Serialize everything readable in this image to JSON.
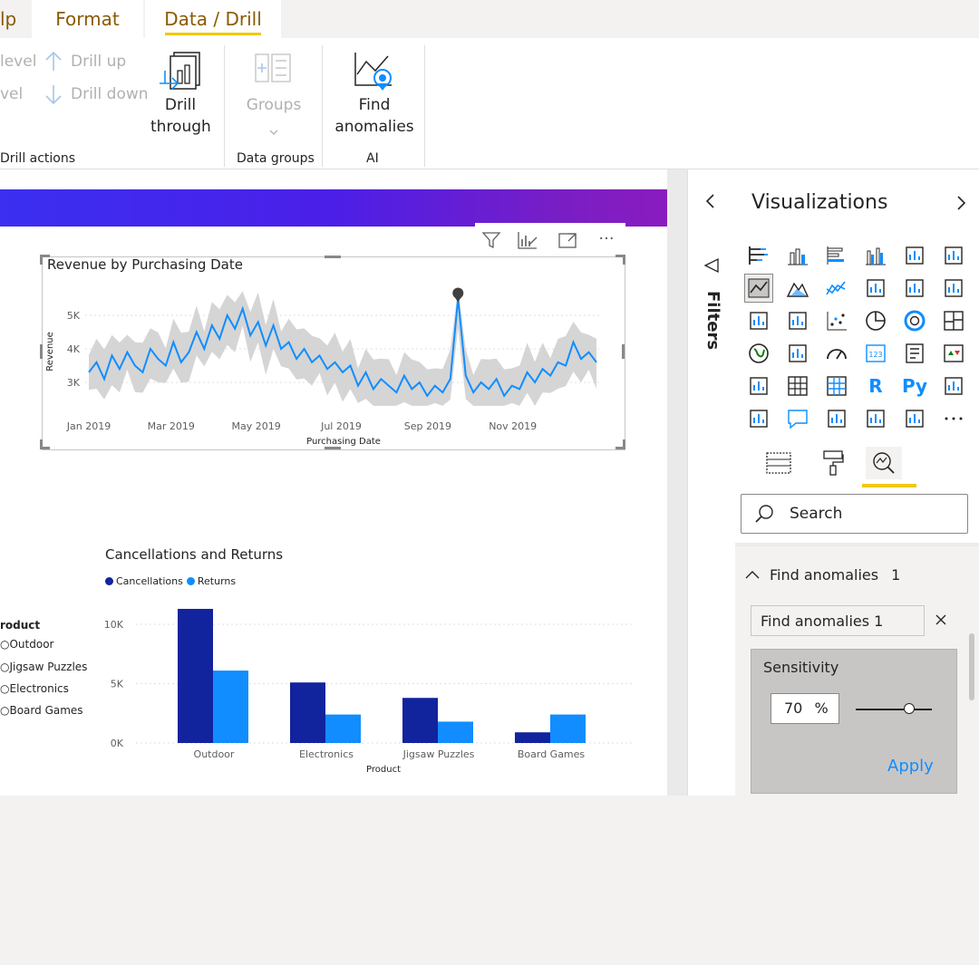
{
  "ribbon": {
    "tabs": [
      {
        "label": "lp",
        "active": false
      },
      {
        "label": "Format",
        "active": false
      },
      {
        "label": "Data / Drill",
        "active": true
      }
    ],
    "drill_actions": {
      "next_level": "level",
      "expand_level": "vel",
      "drill_up": "Drill up",
      "drill_down": "Drill down",
      "drill_through_line1": "Drill",
      "drill_through_line2": "through",
      "group_label": "Drill actions"
    },
    "data_groups": {
      "groups_label": "Groups",
      "group_label": "Data groups"
    },
    "ai": {
      "find_line1": "Find",
      "find_line2": "anomalies",
      "group_label": "AI"
    },
    "accent_color": "#f2c811"
  },
  "line_chart": {
    "title": "Revenue by Purchasing Date",
    "xlabel": "Purchasing Date",
    "ylabel": "Revenue",
    "y_ticks": [
      "5K",
      "4K",
      "3K"
    ],
    "x_ticks": [
      "Jan 2019",
      "Mar 2019",
      "May 2019",
      "Jul 2019",
      "Sep 2019",
      "Nov 2019"
    ],
    "line_color": "#118dff",
    "band_color": "#d0d0d0",
    "anomaly_color": "#404040"
  },
  "bar_chart": {
    "title": "Cancellations and Returns",
    "legend": [
      {
        "name": "Cancellations",
        "color": "#12239e"
      },
      {
        "name": "Returns",
        "color": "#118dff"
      }
    ],
    "y_ticks": [
      "10K",
      "5K",
      "0K"
    ],
    "xlabel": "Product"
  },
  "slicer": {
    "title": "roduct",
    "items": [
      "Outdoor",
      "Jigsaw Puzzles",
      "Electronics",
      "Board Games"
    ]
  },
  "filters": {
    "label": "Filters"
  },
  "visualizations": {
    "title": "Visualizations",
    "search_placeholder": "Search",
    "section_title": "Find anomalies",
    "section_count": "1",
    "item_name": "Find anomalies 1",
    "sensitivity_label": "Sensitivity",
    "sensitivity_value": "70",
    "sensitivity_unit": "%",
    "sensitivity_fraction": 0.7,
    "apply_label": "Apply",
    "more_label": "···",
    "r_label": "R",
    "py_label": "Py",
    "num_label": "123"
  },
  "chart_data": [
    {
      "type": "line",
      "title": "Revenue by Purchasing Date",
      "xlabel": "Purchasing Date",
      "ylabel": "Revenue",
      "ylim": [
        2200,
        5800
      ],
      "x_range": [
        "2019-01-01",
        "2019-12-31"
      ],
      "series": [
        {
          "values": [
            3300,
            3600,
            3100,
            3800,
            3400,
            3900,
            3500,
            3300,
            4000,
            3700,
            3500,
            4200,
            3600,
            3900,
            4500,
            4000,
            4700,
            4300,
            5000,
            4600,
            5200,
            4400,
            4800,
            4100,
            4700,
            4000,
            4200,
            3700,
            4000,
            3600,
            3800,
            3400,
            3600,
            3300,
            3500,
            2900,
            3300,
            2800,
            3100,
            2900,
            2700,
            3200,
            2800,
            3000,
            2600,
            2900,
            2700,
            3100,
            5500,
            3200,
            2700,
            3000,
            2800,
            3100,
            2600,
            2900,
            2800,
            3300,
            3000,
            3400,
            3200,
            3600,
            3500,
            4200,
            3700,
            3900,
            3600
          ],
          "anomaly": {
            "x": "2019-09-01",
            "y": 5500
          }
        }
      ]
    },
    {
      "type": "bar",
      "title": "Cancellations and Returns",
      "xlabel": "Product",
      "categories": [
        "Outdoor",
        "Electronics",
        "Jigsaw Puzzles",
        "Board Games"
      ],
      "ylim": [
        0,
        12000
      ],
      "series": [
        {
          "name": "Cancellations",
          "values": [
            11300,
            5100,
            3800,
            900
          ]
        },
        {
          "name": "Returns",
          "values": [
            6100,
            2400,
            1800,
            2400
          ]
        }
      ]
    }
  ]
}
